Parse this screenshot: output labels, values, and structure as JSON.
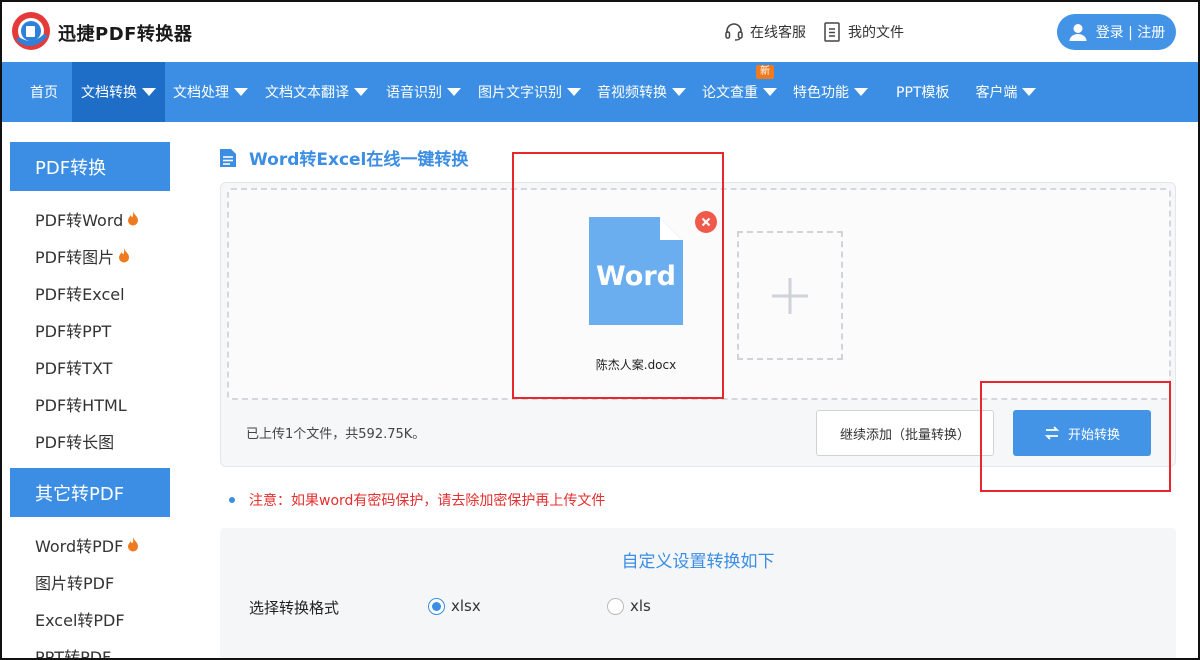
{
  "header": {
    "app_title": "迅捷PDF转换器",
    "support_label": "在线客服",
    "myfiles_label": "我的文件",
    "login_label": "登录 | 注册"
  },
  "nav": {
    "items": [
      {
        "label": "首页"
      },
      {
        "label": "文档转换"
      },
      {
        "label": "文档处理"
      },
      {
        "label": "文档文本翻译"
      },
      {
        "label": "语音识别"
      },
      {
        "label": "图片文字识别"
      },
      {
        "label": "音视频转换"
      },
      {
        "label": "论文查重",
        "badge": "新"
      },
      {
        "label": "特色功能"
      },
      {
        "label": "PPT模板"
      },
      {
        "label": "客户端"
      }
    ]
  },
  "sidebar": {
    "section1_title": "PDF转换",
    "section1_items": [
      "PDF转Word",
      "PDF转图片",
      "PDF转Excel",
      "PDF转PPT",
      "PDF转TXT",
      "PDF转HTML",
      "PDF转长图"
    ],
    "section2_title": "其它转PDF",
    "section2_items": [
      "Word转PDF",
      "图片转PDF",
      "Excel转PDF",
      "PPT转PDF"
    ]
  },
  "main": {
    "title": "Word转Excel在线一键转换",
    "file_icon_text": "Word",
    "file_name": "陈杰人案.docx",
    "upload_info": "已上传1个文件，共592.75K。",
    "add_more_label": "继续添加（批量转换）",
    "start_label": "开始转换",
    "notice": "注意：如果word有密码保护，请去除加密保护再上传文件"
  },
  "settings": {
    "title": "自定义设置转换如下",
    "format_label": "选择转换格式",
    "options": [
      {
        "label": "xlsx",
        "selected": true
      },
      {
        "label": "xls",
        "selected": false
      }
    ]
  },
  "colors": {
    "brand_blue": "#3b8ee3",
    "nav_active": "#1e6dc6",
    "notice_red": "#e52e2e",
    "annotation_red": "#e8262b",
    "fire_orange": "#f07a20"
  }
}
